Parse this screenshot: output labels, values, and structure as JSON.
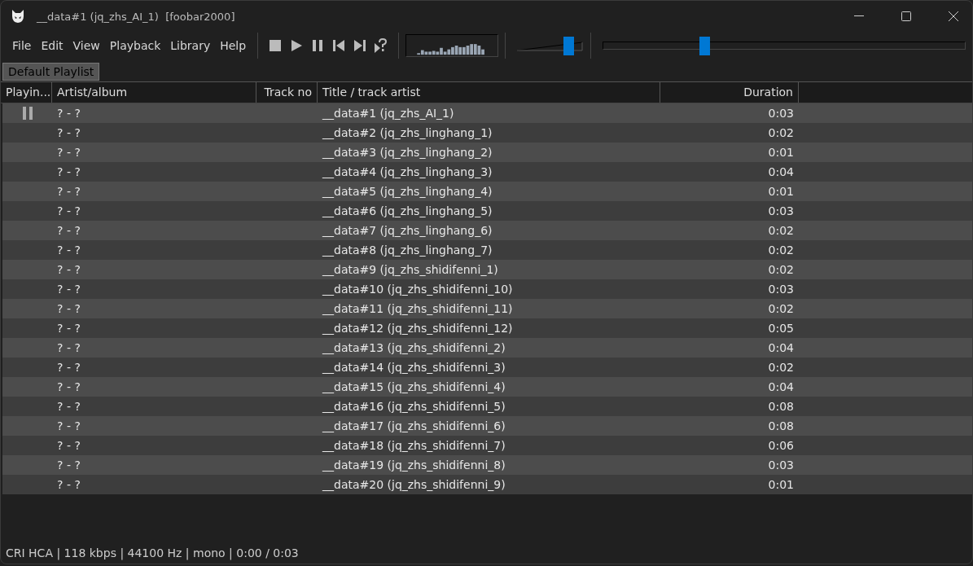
{
  "window": {
    "title": "__data#1 (jq_zhs_AI_1)  [foobar2000]"
  },
  "menu": [
    "File",
    "Edit",
    "View",
    "Playback",
    "Library",
    "Help"
  ],
  "volume": {
    "level": 0.78
  },
  "seek": {
    "level": 0.28
  },
  "tabs": [
    {
      "label": "Default Playlist",
      "selected": true
    }
  ],
  "columns": [
    {
      "label": "Playin..."
    },
    {
      "label": "Artist/album"
    },
    {
      "label": "Track no"
    },
    {
      "label": "Title / track artist"
    },
    {
      "label": "Duration"
    }
  ],
  "rows": [
    {
      "playing": true,
      "artist": "? - ?",
      "title": "__data#1 (jq_zhs_AI_1)",
      "duration": "0:03"
    },
    {
      "playing": false,
      "artist": "? - ?",
      "title": "__data#2 (jq_zhs_linghang_1)",
      "duration": "0:02"
    },
    {
      "playing": false,
      "artist": "? - ?",
      "title": "__data#3 (jq_zhs_linghang_2)",
      "duration": "0:01"
    },
    {
      "playing": false,
      "artist": "? - ?",
      "title": "__data#4 (jq_zhs_linghang_3)",
      "duration": "0:04"
    },
    {
      "playing": false,
      "artist": "? - ?",
      "title": "__data#5 (jq_zhs_linghang_4)",
      "duration": "0:01"
    },
    {
      "playing": false,
      "artist": "? - ?",
      "title": "__data#6 (jq_zhs_linghang_5)",
      "duration": "0:03"
    },
    {
      "playing": false,
      "artist": "? - ?",
      "title": "__data#7 (jq_zhs_linghang_6)",
      "duration": "0:02"
    },
    {
      "playing": false,
      "artist": "? - ?",
      "title": "__data#8 (jq_zhs_linghang_7)",
      "duration": "0:02"
    },
    {
      "playing": false,
      "artist": "? - ?",
      "title": "__data#9 (jq_zhs_shidifenni_1)",
      "duration": "0:02"
    },
    {
      "playing": false,
      "artist": "? - ?",
      "title": "__data#10 (jq_zhs_shidifenni_10)",
      "duration": "0:03"
    },
    {
      "playing": false,
      "artist": "? - ?",
      "title": "__data#11 (jq_zhs_shidifenni_11)",
      "duration": "0:02"
    },
    {
      "playing": false,
      "artist": "? - ?",
      "title": "__data#12 (jq_zhs_shidifenni_12)",
      "duration": "0:05"
    },
    {
      "playing": false,
      "artist": "? - ?",
      "title": "__data#13 (jq_zhs_shidifenni_2)",
      "duration": "0:04"
    },
    {
      "playing": false,
      "artist": "? - ?",
      "title": "__data#14 (jq_zhs_shidifenni_3)",
      "duration": "0:02"
    },
    {
      "playing": false,
      "artist": "? - ?",
      "title": "__data#15 (jq_zhs_shidifenni_4)",
      "duration": "0:04"
    },
    {
      "playing": false,
      "artist": "? - ?",
      "title": "__data#16 (jq_zhs_shidifenni_5)",
      "duration": "0:08"
    },
    {
      "playing": false,
      "artist": "? - ?",
      "title": "__data#17 (jq_zhs_shidifenni_6)",
      "duration": "0:08"
    },
    {
      "playing": false,
      "artist": "? - ?",
      "title": "__data#18 (jq_zhs_shidifenni_7)",
      "duration": "0:06"
    },
    {
      "playing": false,
      "artist": "? - ?",
      "title": "__data#19 (jq_zhs_shidifenni_8)",
      "duration": "0:03"
    },
    {
      "playing": false,
      "artist": "? - ?",
      "title": "__data#20 (jq_zhs_shidifenni_9)",
      "duration": "0:01"
    }
  ],
  "status_bar": "CRI HCA | 118 kbps | 44100 Hz | mono | 0:00 / 0:03"
}
